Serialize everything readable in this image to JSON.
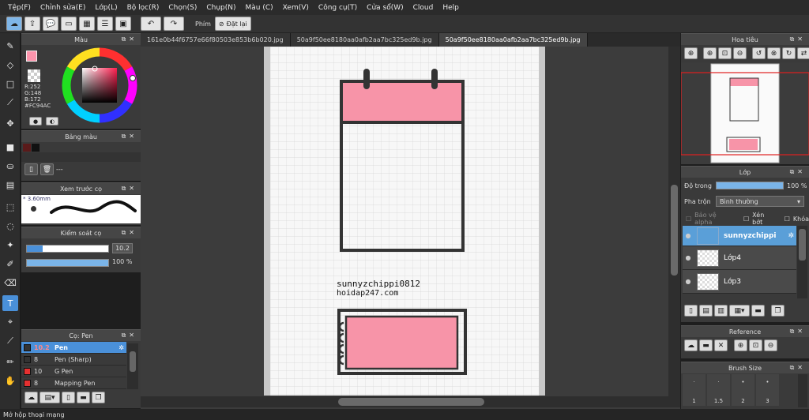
{
  "menu": [
    "Tệp(F)",
    "Chỉnh sửa(E)",
    "Lớp(L)",
    "Bộ lọc(R)",
    "Chọn(S)",
    "Chụp(N)",
    "Màu (C)",
    "Xem(V)",
    "Công cụ(T)",
    "Cửa sổ(W)",
    "Cloud",
    "Help"
  ],
  "toolbar": {
    "snap_label": "Phím",
    "reset_label": "Đặt lại"
  },
  "color_panel": {
    "title": "Màu",
    "r": "R:252",
    "g": "G:148",
    "b": "B:172",
    "hex": "#FC94AC",
    "fg": "#FC94AC"
  },
  "palette_panel": {
    "title": "Bảng màu",
    "dash": "---"
  },
  "preview_panel": {
    "title": "Xem trước cọ",
    "size": "* 3.60mm"
  },
  "control_panel": {
    "title": "Kiểm soát cọ",
    "size_value": "10.2",
    "opacity_value": "100 %"
  },
  "brush_panel": {
    "title": "Cọ: Pen",
    "brushes": [
      {
        "size": "10.2",
        "name": "Pen",
        "color": "#333333"
      },
      {
        "size": "8",
        "name": "Pen (Sharp)",
        "color": "#333333"
      },
      {
        "size": "10",
        "name": "G Pen",
        "color": "#e53030"
      },
      {
        "size": "8",
        "name": "Mapping Pen",
        "color": "#e53030"
      }
    ]
  },
  "tabs": [
    "161e0b44f6757e66f80503e853b6b020.jpg",
    "50a9f50ee8180aa0afb2aa7bc325ed9b.jpg",
    "50a9f50ee8180aa0afb2aa7bc325ed9b.jpg"
  ],
  "canvas": {
    "watermark_line1": "sunnyzchippi0812",
    "watermark_line2": "hoidap247.com",
    "pink": "#F794A8"
  },
  "navigator": {
    "title": "Hoa tiêu"
  },
  "layer_panel": {
    "title": "Lớp",
    "opacity_label": "Độ trong",
    "opacity_value": "100 %",
    "blend_label": "Pha trộn",
    "blend_value": "Bình thường",
    "protect_alpha": "Bảo vệ alpha",
    "clipping": "Xén bớt",
    "lock": "Khóa",
    "layers": [
      {
        "name": "sunnyzchippi"
      },
      {
        "name": "Lớp4"
      },
      {
        "name": "Lớp3"
      }
    ]
  },
  "reference_panel": {
    "title": "Reference"
  },
  "brushsize_panel": {
    "title": "Brush Size",
    "sizes": [
      "1",
      "1.5",
      "2",
      "3"
    ]
  },
  "status": {
    "text": "Mở hộp thoại mạng"
  }
}
